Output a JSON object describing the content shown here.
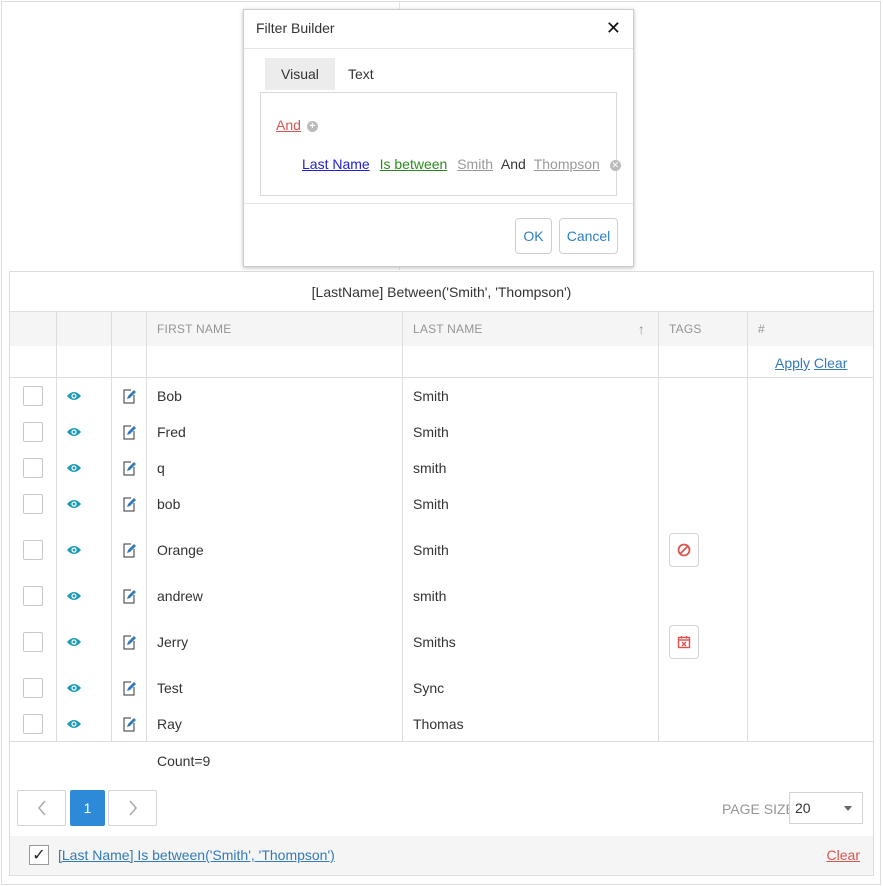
{
  "dialog": {
    "title": "Filter Builder",
    "tabs": [
      "Visual",
      "Text"
    ],
    "group_operator": "And",
    "condition": {
      "field": "Last Name",
      "operation": "Is between",
      "value1": "Smith",
      "joiner": "And",
      "value2": "Thompson"
    },
    "ok_label": "OK",
    "cancel_label": "Cancel"
  },
  "grid": {
    "filter_expression": "[LastName] Between('Smith', 'Thompson')",
    "columns": [
      "FIRST NAME",
      "LAST NAME",
      "TAGS",
      "#"
    ],
    "sort": {
      "column": "LAST NAME",
      "direction": "ascending"
    },
    "apply_label": "Apply",
    "clear_label": "Clear",
    "rows": [
      {
        "first": "Bob",
        "last": "Smith",
        "tag": ""
      },
      {
        "first": "Fred",
        "last": "Smith",
        "tag": ""
      },
      {
        "first": "q",
        "last": "smith",
        "tag": ""
      },
      {
        "first": "bob",
        "last": "Smith",
        "tag": ""
      },
      {
        "first": "Orange",
        "last": "Smith",
        "tag": "ban-icon"
      },
      {
        "first": "andrew",
        "last": "smith",
        "tag": ""
      },
      {
        "first": "Jerry",
        "last": "Smiths",
        "tag": "calendar-x-icon"
      },
      {
        "first": "Test",
        "last": "Sync",
        "tag": ""
      },
      {
        "first": "Ray",
        "last": "Thomas",
        "tag": ""
      }
    ],
    "count_text": "Count=9",
    "pager": {
      "current_page": "1",
      "page_size_label": "PAGE SIZE",
      "page_size": "20"
    },
    "filter_panel": {
      "text": "[Last Name] Is between('Smith', 'Thompson')",
      "clear_label": "Clear",
      "checked": true
    }
  },
  "colors": {
    "accent": "#2d8ad8",
    "danger": "#d9534f",
    "field": "#2121d6",
    "operation": "#2a8c1e",
    "eye": "#1b9bb8"
  }
}
